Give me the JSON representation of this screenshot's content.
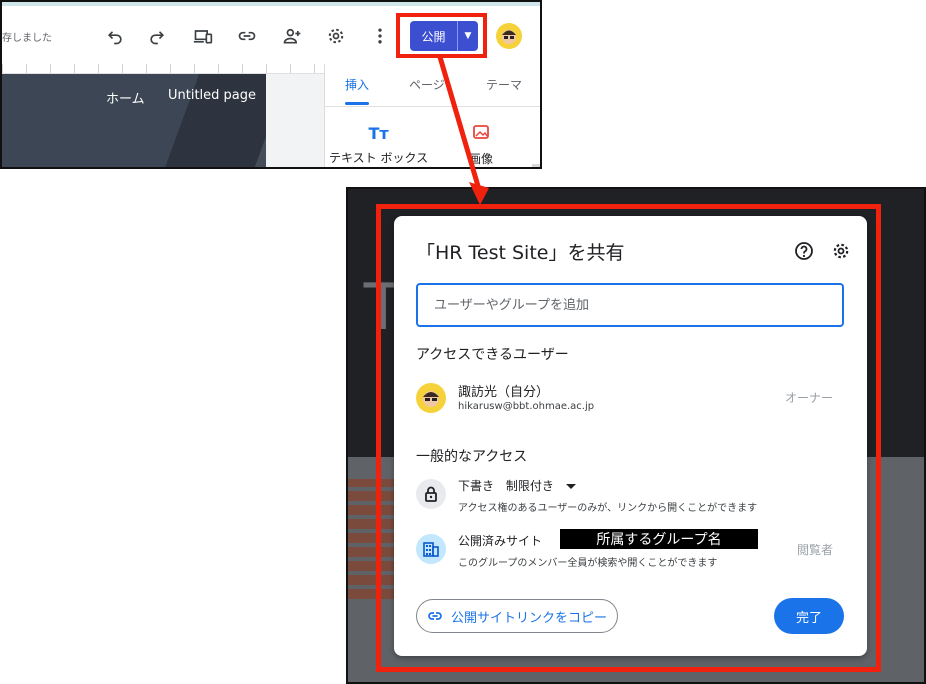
{
  "toolbar": {
    "saved_status": "存しました",
    "publish_label": "公開",
    "icons": [
      "undo-icon",
      "redo-icon",
      "preview-device-icon",
      "link-icon",
      "add-person-icon",
      "gear-icon",
      "more-vert-icon"
    ]
  },
  "site_nav": {
    "home": "ホーム",
    "untitled": "Untitled page"
  },
  "side_panel": {
    "tabs": [
      {
        "label": "挿入",
        "active": true
      },
      {
        "label": "ページ",
        "active": false
      },
      {
        "label": "テーマ",
        "active": false
      }
    ],
    "text_box_icon": "Tт",
    "text_box": "テキスト ボックス",
    "image": "画像"
  },
  "dialog": {
    "title": "「HR Test Site」を共有",
    "input_placeholder": "ユーザーやグループを追加",
    "access_users_heading": "アクセスできるユーザー",
    "owner": {
      "name": "諏訪光（自分）",
      "email": "hikarusw@bbt.ohmae.ac.jp",
      "role": "オーナー"
    },
    "general_access_heading": "一般的なアクセス",
    "draft": {
      "label": "下書き",
      "setting": "制限付き",
      "description": "アクセス権のあるユーザーのみが、リンクから開くことができます"
    },
    "published": {
      "label": "公開済みサイト",
      "group_label": "所属するグループ名",
      "description": "このグループのメンバー全員が検索や開くことができます",
      "role": "閲覧者"
    },
    "copy_link_label": "公開サイトリンクをコピー",
    "done_label": "完了"
  },
  "colors": {
    "accent": "#1a73e8",
    "publish": "#3c4fd1",
    "annotation_red": "#f0220e"
  }
}
